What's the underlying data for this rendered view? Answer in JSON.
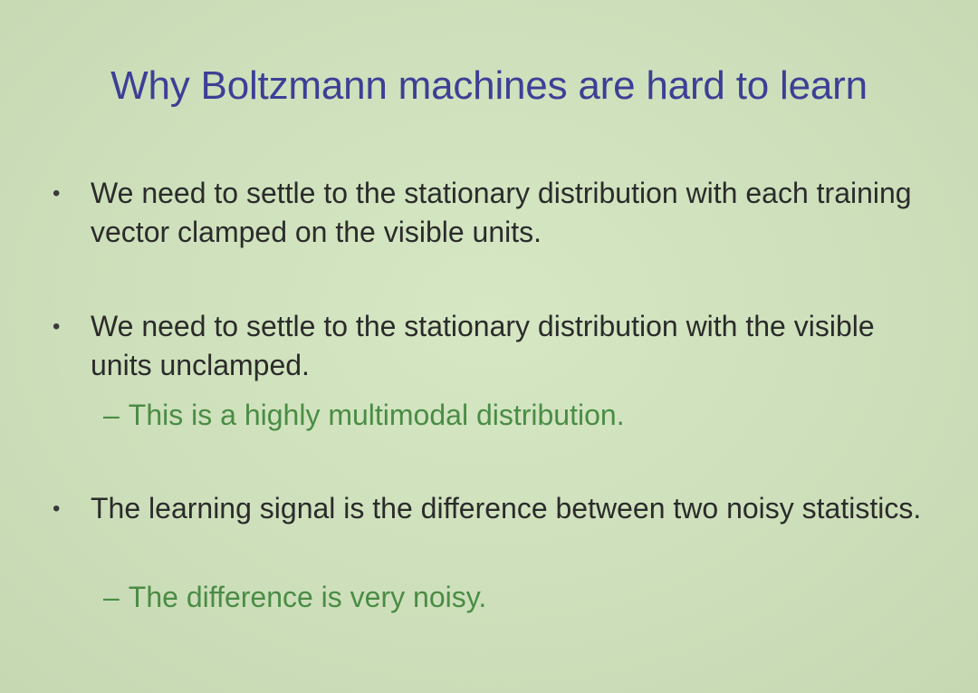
{
  "slide": {
    "title": "Why Boltzmann machines are hard to learn",
    "bullets": [
      {
        "marker": "•",
        "text": "We need to settle to the stationary distribution with each training vector clamped on the visible units.",
        "sub": []
      },
      {
        "marker": "•",
        "text": "We need to settle to the stationary distribution with the visible units unclamped.",
        "sub": [
          {
            "marker": "–",
            "text": "This is a highly multimodal distribution."
          }
        ]
      },
      {
        "marker": "•",
        "text": "The learning signal is the difference between two noisy statistics.",
        "sub": [
          {
            "marker": "–",
            "text": "The difference is very noisy."
          }
        ]
      }
    ]
  },
  "colors": {
    "background": "#cfe2bd",
    "title": "#3d3f96",
    "body_text": "#2b2b2b",
    "sub_text": "#4a8c45"
  }
}
